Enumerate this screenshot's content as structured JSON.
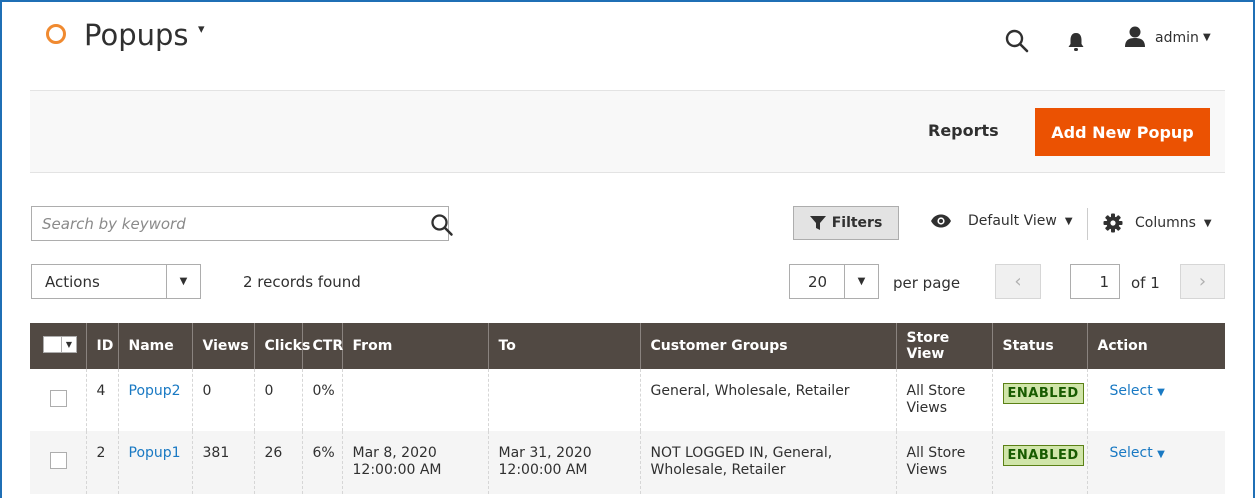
{
  "header": {
    "title": "Popups",
    "user": "admin"
  },
  "action_bar": {
    "reports_label": "Reports",
    "add_label": "Add New Popup"
  },
  "toolbar": {
    "search_placeholder": "Search by keyword",
    "filters_label": "Filters",
    "view_label": "Default View",
    "columns_label": "Columns",
    "actions_label": "Actions",
    "records_found": "2 records found",
    "per_page_value": "20",
    "per_page_label": "per page",
    "page_value": "1",
    "page_of": "of 1"
  },
  "grid": {
    "columns": [
      "ID",
      "Name",
      "Views",
      "Clicks",
      "CTR",
      "From",
      "To",
      "Customer Groups",
      "Store View",
      "Status",
      "Action"
    ],
    "rows": [
      {
        "id": "4",
        "name": "Popup2",
        "views": "0",
        "clicks": "0",
        "ctr": "0%",
        "from_date": "",
        "from_time": "",
        "to_date": "",
        "to_time": "",
        "groups_l1": "General, Wholesale, Retailer",
        "groups_l2": "",
        "store_l1": "All Store",
        "store_l2": "Views",
        "status": "ENABLED",
        "action": "Select"
      },
      {
        "id": "2",
        "name": "Popup1",
        "views": "381",
        "clicks": "26",
        "ctr": "6%",
        "from_date": "Mar 8, 2020",
        "from_time": "12:00:00 AM",
        "to_date": "Mar 31, 2020",
        "to_time": "12:00:00 AM",
        "groups_l1": "NOT LOGGED IN, General,",
        "groups_l2": "Wholesale, Retailer",
        "store_l1": "All Store",
        "store_l2": "Views",
        "status": "ENABLED",
        "action": "Select"
      }
    ]
  },
  "colors": {
    "accent": "#eb5202",
    "header_bg": "#514943",
    "link": "#1979c3",
    "logo": "#f08a30"
  }
}
